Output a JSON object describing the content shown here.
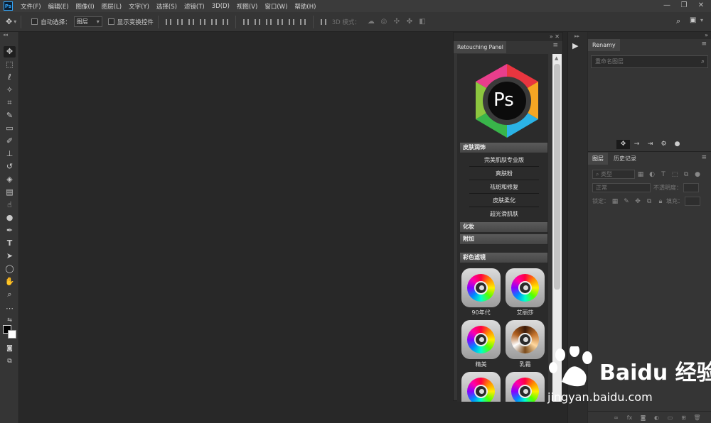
{
  "app": {
    "logo": "Ps"
  },
  "menu": {
    "items": [
      "文件(F)",
      "编辑(E)",
      "图像(I)",
      "图层(L)",
      "文字(Y)",
      "选择(S)",
      "滤镜(T)",
      "3D(D)",
      "视图(V)",
      "窗口(W)",
      "帮助(H)"
    ]
  },
  "window_controls": {
    "minimize": "—",
    "restore": "❐",
    "close": "✕"
  },
  "options": {
    "auto_select_label": "自动选择：",
    "auto_select_value": "图层",
    "show_transform_label": "显示变换控件",
    "mode3d_label": "3D 模式："
  },
  "tools": [
    "move",
    "marquee",
    "lasso",
    "magic-wand",
    "crop",
    "eyedropper",
    "frame",
    "brush",
    "stamp",
    "history-brush",
    "eraser",
    "gradient",
    "smudge",
    "dodge",
    "pen",
    "type",
    "path-select",
    "ellipse",
    "hand",
    "zoom",
    "more",
    "swap",
    "colors",
    "quick-mask",
    "screen-mode"
  ],
  "retouch_panel": {
    "tab_label": "Retouching Panel",
    "logo_text": "Ps",
    "sections": {
      "skin": "皮肤润饰",
      "makeup": "化妆",
      "extra": "附加",
      "color_filter": "彩色滤镜"
    },
    "skin_items": [
      "完美肌肤专业版",
      "爽肤粉",
      "祛斑和修复",
      "皮肤柔化",
      "超光滑肌肤"
    ],
    "filters": [
      {
        "name": "90年代"
      },
      {
        "name": "艾丽莎"
      },
      {
        "name": "精美"
      },
      {
        "name": "乳霜"
      }
    ]
  },
  "renamy": {
    "tab_label": "Renamy",
    "search_placeholder": "重命名图层"
  },
  "layers": {
    "tab_layers": "图层",
    "tab_history": "历史记录",
    "kind_label": "类型",
    "blend_mode": "正常",
    "opacity_label": "不透明度：",
    "lock_label": "锁定：",
    "fill_label": "填充："
  },
  "watermark": {
    "brand": "Baidu 经验",
    "url": "jingyan.baidu.com"
  }
}
